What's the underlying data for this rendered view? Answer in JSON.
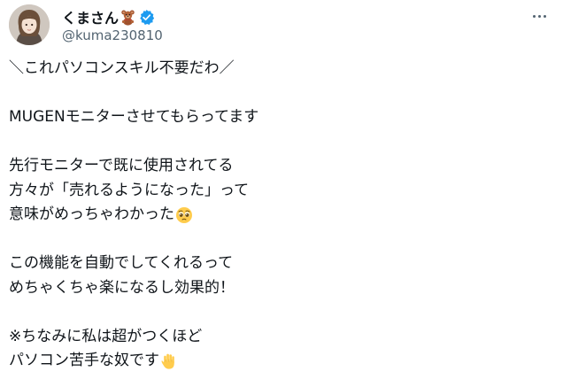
{
  "author": {
    "display_name": "くまさん",
    "handle": "@kuma230810",
    "avatar_icon": "avatar-image",
    "badge_icons": [
      "teddy-bear-icon",
      "verified-badge-icon"
    ]
  },
  "more_icon": "more-options-icon",
  "tweet": {
    "lines": [
      "＼これパソコンスキル不要だわ／",
      "",
      "MUGENモニターさせてもらってます",
      "",
      "先行モニターで既に使用されてる",
      "方々が「売れるようになった」って",
      "意味がめっちゃわかった",
      "",
      "この機能を自動でしてくれるって",
      "めちゃくちゃ楽になるし効果的！",
      "",
      "※ちなみに私は超がつくほど",
      "パソコン苦手な奴です"
    ],
    "inline_emojis": {
      "6": "pleading-face-icon",
      "12": "raised-hand-icon"
    }
  },
  "colors": {
    "text": "#0f1419",
    "secondary": "#536471",
    "verified": "#1d9bf0"
  }
}
